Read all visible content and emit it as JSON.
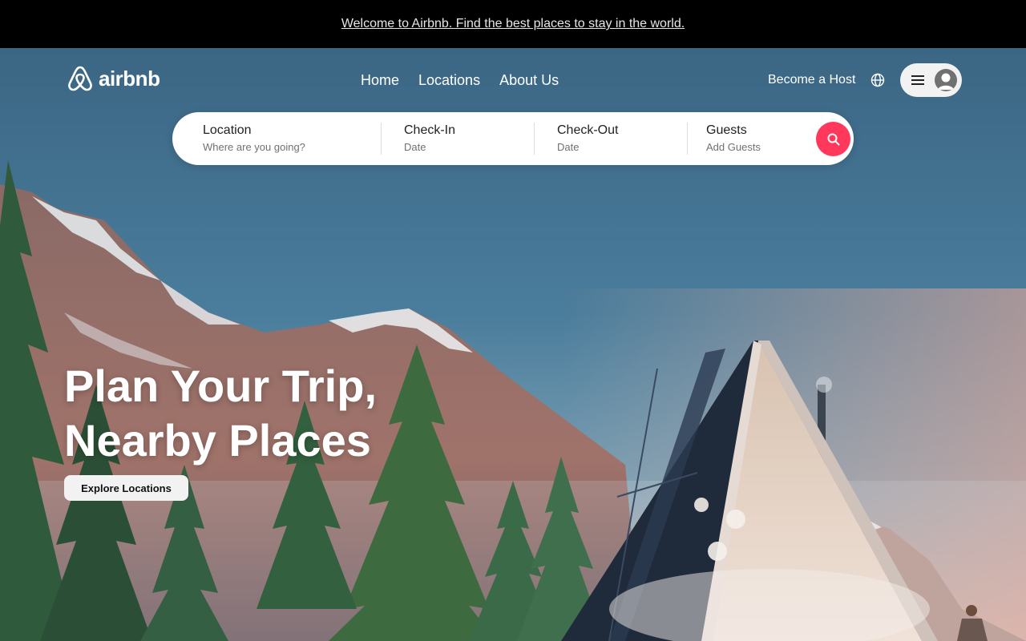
{
  "announcement": {
    "text": "Welcome to Airbnb. Find the best places to stay in the world."
  },
  "header": {
    "logo_text": "airbnb",
    "nav": [
      {
        "label": "Home"
      },
      {
        "label": "Locations"
      },
      {
        "label": "About Us"
      }
    ],
    "become_host_label": "Become a Host",
    "globe_icon": "globe-icon",
    "menu_icon": "hamburger-menu-icon",
    "avatar_icon": "user-avatar-icon"
  },
  "search": {
    "location": {
      "label": "Location",
      "placeholder": "Where are you going?"
    },
    "check_in": {
      "label": "Check-In",
      "value": "Date"
    },
    "check_out": {
      "label": "Check-Out",
      "value": "Date"
    },
    "guests": {
      "label": "Guests",
      "value": "Add Guests"
    },
    "button_icon": "search-icon"
  },
  "hero": {
    "headline_line1": "Plan Your Trip,",
    "headline_line2": "Nearby Places",
    "cta_label": "Explore Locations"
  },
  "colors": {
    "accent": "#ff385c",
    "announcement_bg": "#000000",
    "sky": "#3d6c8c"
  }
}
